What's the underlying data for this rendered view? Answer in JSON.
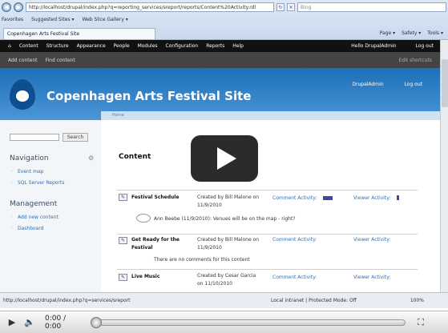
{
  "browser": {
    "address": "http://localhost/drupal/index.php?q=reporting_services/sreport/reports/Content%20Activity.rdl",
    "search_placeholder": "Bing",
    "favorites_label": "Favorites",
    "suggested_sites": "Suggested Sites ▾",
    "web_slice": "Web Slice Gallery ▾",
    "tab_title": "Copenhagen Arts Festival Site",
    "tools": [
      "Page ▾",
      "Safety ▾",
      "Tools ▾"
    ]
  },
  "admin_bar": {
    "items": [
      "Content",
      "Structure",
      "Appearance",
      "People",
      "Modules",
      "Configuration",
      "Reports",
      "Help"
    ],
    "hello": "Hello DrupalAdmin",
    "logout": "Log out"
  },
  "shortcuts": {
    "items": [
      "Add content",
      "Find content"
    ],
    "edit": "Edit shortcuts"
  },
  "header": {
    "site_name": "Copenhagen Arts Festival Site",
    "user_link": "DrupalAdmin",
    "logout": "Log out"
  },
  "breadcrumb": "Home",
  "sidebar": {
    "search_button": "Search",
    "nav_title": "Navigation",
    "nav_links": [
      "Event map",
      "SQL Server Reports"
    ],
    "mgmt_title": "Management",
    "mgmt_links": [
      "Add new content",
      "Dashboard"
    ]
  },
  "content": {
    "title": "Content",
    "rows": [
      {
        "title": "Festival Schedule",
        "created": "Created by Bill Malone on 11/9/2010",
        "comment_label": "Comment Activity:",
        "viewer_label": "Viewer Activity:"
      },
      {
        "title": "Get Ready for the Festival",
        "created": "Created by Bill Malone on 11/9/2010",
        "comment_label": "Comment Activity:",
        "viewer_label": "Viewer Activity:"
      },
      {
        "title": "Live Music",
        "created": "Created by Cesar Garcia on 11/10/2010",
        "comment_label": "Comment Activity:",
        "viewer_label": "Viewer Activity:"
      }
    ],
    "comment1": "Ann Beebe (11/9/2010): Venues will be on the map - right?",
    "no_comments": "There are no comments for this content"
  },
  "status_bar": {
    "url": "http://localhost/drupal/index.php?q=services/sreport",
    "zone": "Local intranet | Protected Mode: Off",
    "zoom": "100%"
  },
  "player": {
    "time": "0:00 / 0:00"
  }
}
